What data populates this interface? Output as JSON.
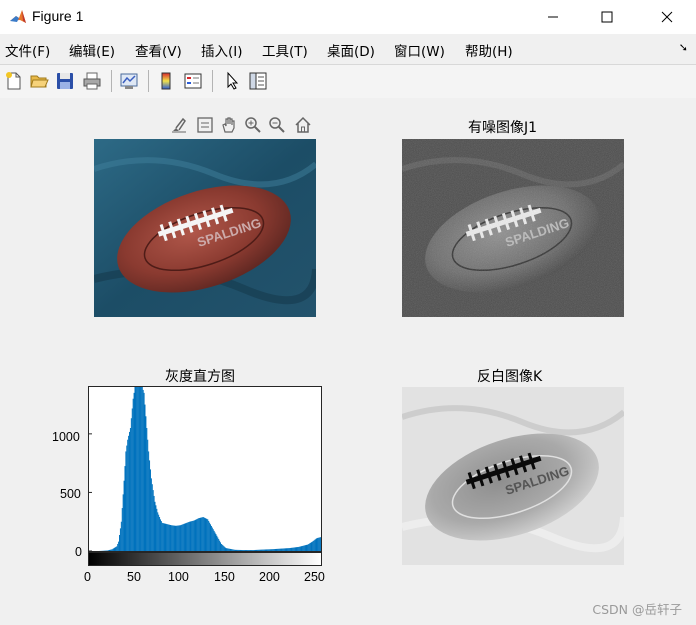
{
  "window": {
    "title": "Figure 1",
    "controls": [
      "minimize",
      "maximize",
      "close"
    ]
  },
  "menu": {
    "items": [
      {
        "label": "文件(F)"
      },
      {
        "label": "编辑(E)"
      },
      {
        "label": "查看(V)"
      },
      {
        "label": "插入(I)"
      },
      {
        "label": "工具(T)"
      },
      {
        "label": "桌面(D)"
      },
      {
        "label": "窗口(W)"
      },
      {
        "label": "帮助(H)"
      }
    ],
    "overflow_icon": "arrow-icon"
  },
  "toolbar": {
    "icons": [
      "new-figure-icon",
      "open-file-icon",
      "save-icon",
      "print-icon",
      "link-plot-icon",
      "insert-colorbar-icon",
      "insert-legend-icon",
      "edit-plot-icon",
      "property-inspector-icon"
    ]
  },
  "axes_toolbar": {
    "icons": [
      "brush-icon",
      "data-tips-icon",
      "pan-icon",
      "zoom-in-icon",
      "zoom-out-icon",
      "home-icon"
    ]
  },
  "subplots": {
    "original": {
      "title": ""
    },
    "noisy": {
      "title": "有噪图像J1"
    },
    "histogram": {
      "title": "灰度直方图"
    },
    "inverted": {
      "title": "反白图像K"
    }
  },
  "colors": {
    "histogram_fill": "#0072bd",
    "window_bg": "#f0f0f0"
  },
  "chart_data": {
    "type": "bar",
    "title": "灰度直方图",
    "xlabel": "",
    "ylabel": "",
    "xlim": [
      0,
      255
    ],
    "ylim": [
      0,
      1400
    ],
    "xticks": [
      "0",
      "50",
      "100",
      "150",
      "200",
      "250"
    ],
    "yticks": [
      "0",
      "500",
      "1000"
    ],
    "colorbar": "grayscale 0-255",
    "x": [
      0,
      10,
      15,
      20,
      25,
      30,
      32,
      35,
      38,
      40,
      42,
      45,
      48,
      50,
      52,
      55,
      58,
      60,
      62,
      65,
      68,
      70,
      72,
      75,
      78,
      80,
      85,
      90,
      95,
      100,
      105,
      110,
      115,
      120,
      125,
      130,
      135,
      140,
      145,
      150,
      160,
      170,
      180,
      190,
      200,
      210,
      220,
      230,
      240,
      245,
      250,
      255
    ],
    "values": [
      0,
      0,
      2,
      5,
      15,
      40,
      80,
      250,
      600,
      850,
      950,
      1050,
      1300,
      1400,
      1400,
      1400,
      1400,
      1350,
      1150,
      850,
      620,
      520,
      420,
      330,
      270,
      240,
      230,
      220,
      215,
      220,
      235,
      250,
      260,
      280,
      290,
      270,
      200,
      130,
      60,
      25,
      10,
      8,
      8,
      12,
      15,
      20,
      25,
      35,
      55,
      80,
      110,
      120
    ]
  },
  "watermark": "CSDN @岳轩子"
}
